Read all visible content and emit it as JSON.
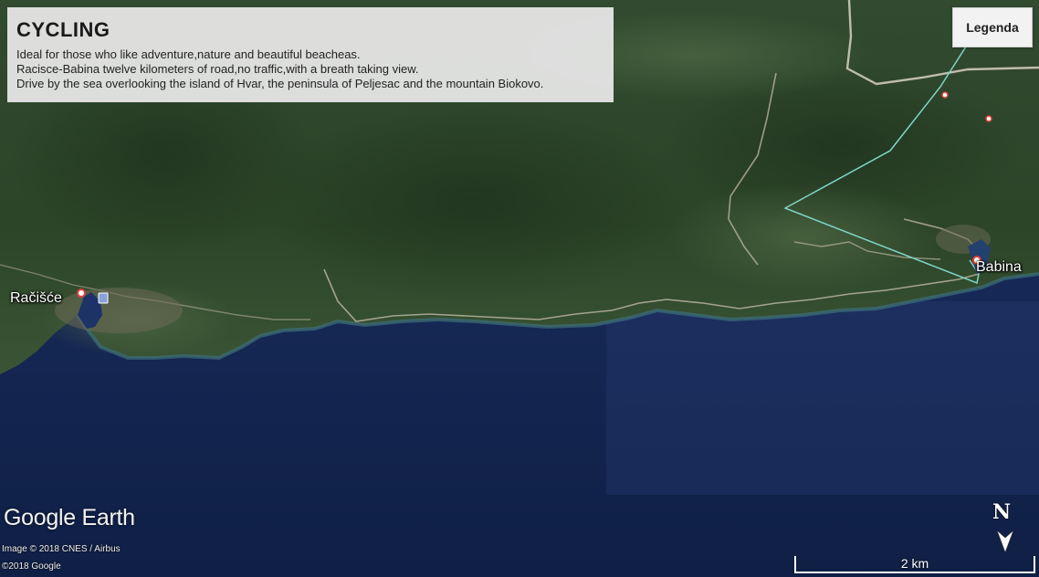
{
  "info": {
    "title": "CYCLING",
    "lines": [
      "Ideal for those who like adventure,nature and beautiful beacheas.",
      "Racisce-Babina twelve kilometers of road,no traffic,with a breath taking view.",
      "Drive by the sea overlooking the island of Hvar, the peninsula of Peljesac and the mountain Biokovo."
    ]
  },
  "legend_button": "Legenda",
  "places": {
    "racisce": "Račišće",
    "babina": "Babina"
  },
  "branding": {
    "logo": "Google Earth",
    "credit_imagery": "Image © 2018 CNES / Airbus",
    "credit_copyright": "©2018 Google"
  },
  "compass": {
    "label": "N"
  },
  "scale": {
    "label": "2 km"
  },
  "colors": {
    "sea": "#16285a",
    "land": "#2f4a2c",
    "route": "#7fd6c8",
    "marker": "#e0403a"
  }
}
